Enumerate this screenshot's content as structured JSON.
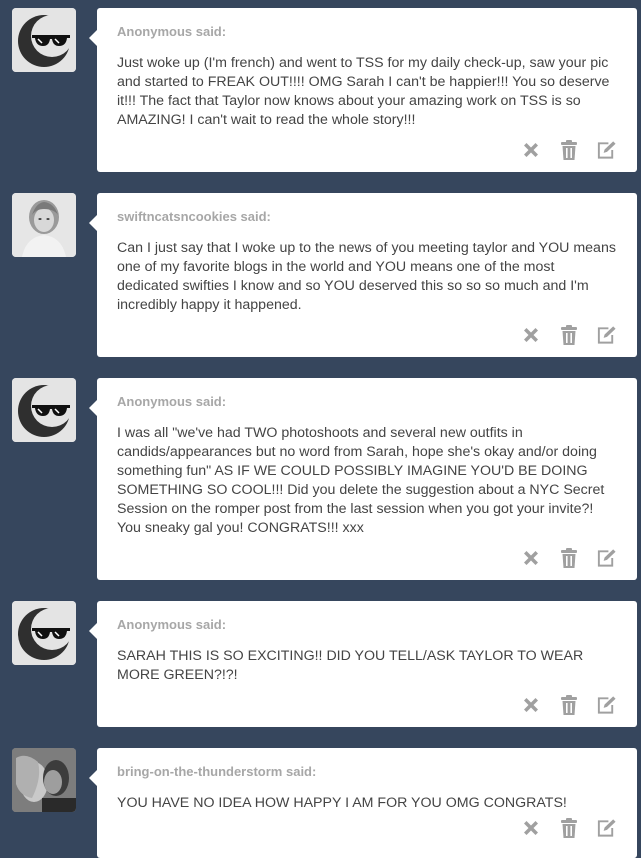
{
  "colors": {
    "background": "#36465d",
    "card": "#ffffff",
    "asker_text": "#a7a7a7",
    "body_text": "#444444",
    "icon": "#a0a0a0"
  },
  "posts": [
    {
      "asker": "Anonymous",
      "said": " said:",
      "avatar": "sunglasses-anon-avatar",
      "question": "Just woke up (I'm french) and went to TSS for my daily check-up, saw your pic and started to FREAK OUT!!!! OMG Sarah I can't be happier!!! You so deserve it!!! The fact that Taylor now knows about your amazing work on TSS is so AMAZING! I can't wait to read the whole story!!!"
    },
    {
      "asker": "swiftncatsncookies",
      "said": " said:",
      "avatar": "photo-avatar-blonde",
      "question": "Can I just say that I woke up to the news of you meeting taylor and YOU means one of my favorite blogs in the world and YOU means one of the most dedicated swifties I know and so YOU deserved this so so so much and I'm incredibly happy it happened."
    },
    {
      "asker": "Anonymous",
      "said": " said:",
      "avatar": "sunglasses-anon-avatar",
      "question": "I was all \"we've had TWO photoshoots and several new outfits in candids/appearances but no word from Sarah, hope she's okay and/or doing something fun\" AS IF WE COULD POSSIBLY IMAGINE YOU'D BE DOING SOMETHING SO COOL!!! Did you delete the suggestion about a NYC Secret Session on the romper post from the last session when you got your invite?! You sneaky gal you! CONGRATS!!! xxx"
    },
    {
      "asker": "Anonymous",
      "said": " said:",
      "avatar": "sunglasses-anon-avatar",
      "question": "SARAH THIS IS SO EXCITING!! DID YOU TELL/ASK TAYLOR TO WEAR MORE GREEN?!?!"
    },
    {
      "asker": "bring-on-the-thunderstorm",
      "said": " said:",
      "avatar": "photo-avatar-couple",
      "question": "YOU HAVE NO IDEA HOW HAPPY I AM FOR YOU OMG CONGRATS!"
    }
  ],
  "actions": [
    "delete-icon",
    "trash-icon",
    "edit-icon"
  ]
}
